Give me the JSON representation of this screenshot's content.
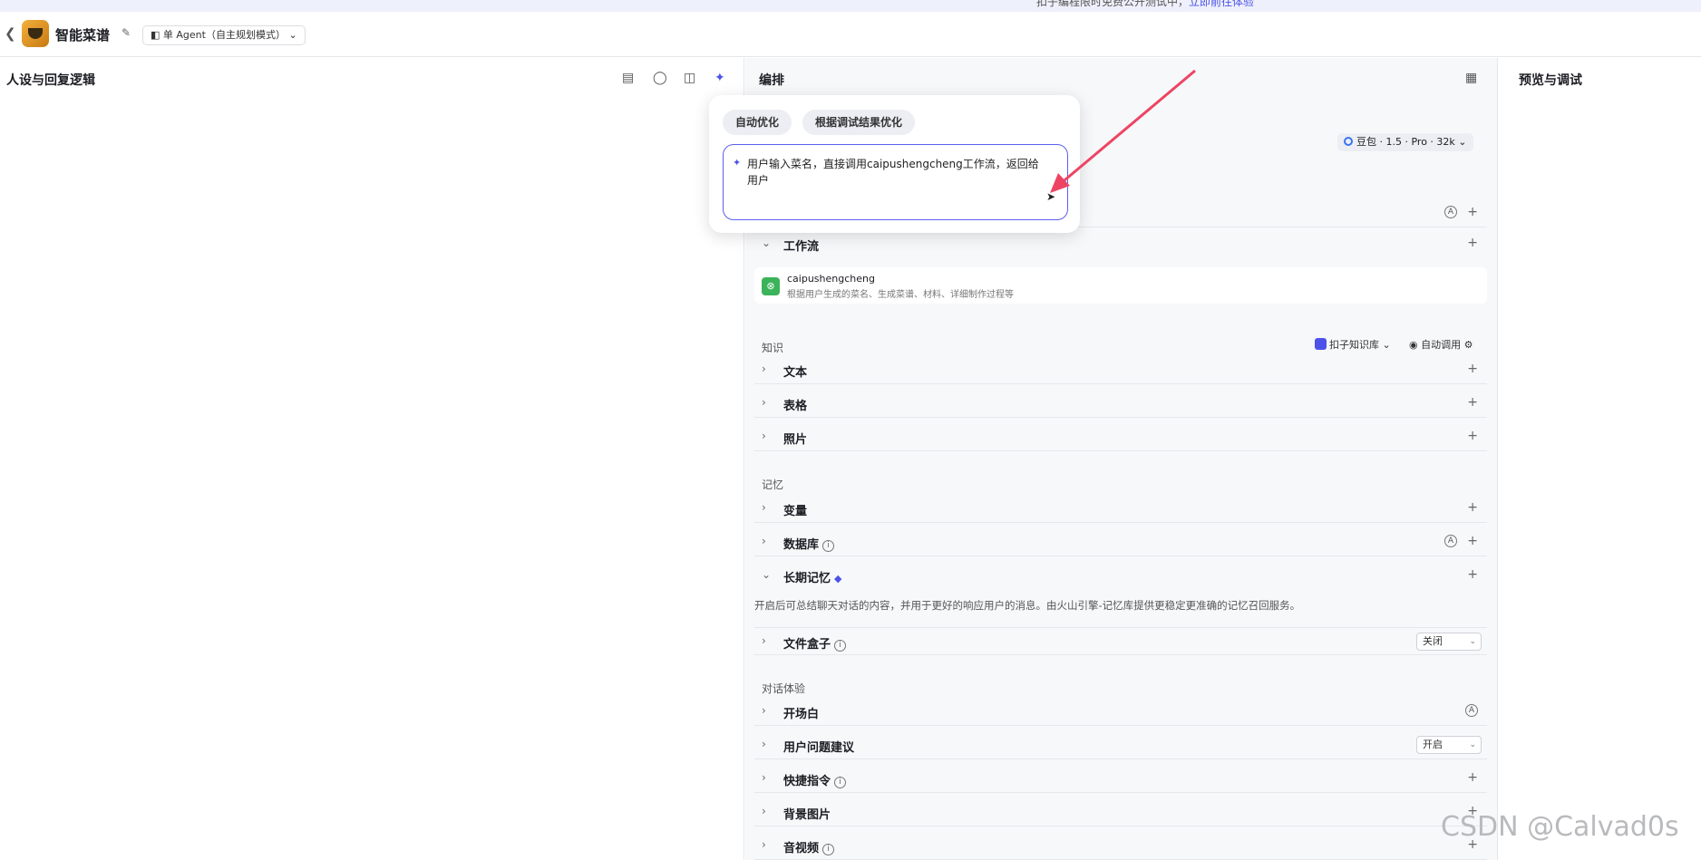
{
  "banner": {
    "text": "扣子编程限时免费公开测试中，",
    "link": "立即前往体验"
  },
  "header": {
    "app_name": "智能菜谱",
    "mode_label": "单 Agent（自主规划模式）"
  },
  "left_panel": {
    "title": "人设与回复逻辑"
  },
  "middle_panel": {
    "title": "编排",
    "model": "豆包 · 1.5 · Pro · 32k",
    "workflow_group": {
      "label": "工作流",
      "item_name": "caipushengcheng",
      "item_desc": "根据用户生成的菜名、生成菜谱、材料、详细制作过程等"
    },
    "knowledge": {
      "label": "知识",
      "kb_source": "扣子知识库",
      "call_mode": "自动调用",
      "items": [
        "文本",
        "表格",
        "照片"
      ]
    },
    "memory": {
      "label": "记忆",
      "variables": "变量",
      "database": "数据库",
      "long_term": "长期记忆",
      "long_term_desc": "开启后可总结聊天对话的内容，并用于更好的响应用户的消息。由火山引擎-记忆库提供更稳定更准确的记忆召回服务。",
      "file_box": "文件盒子",
      "file_box_value": "关闭"
    },
    "experience": {
      "label": "对话体验",
      "opening": "开场白",
      "suggestions": "用户问题建议",
      "suggestions_value": "开启",
      "shortcuts": "快捷指令",
      "background": "背景图片",
      "media": "音视频"
    }
  },
  "right_panel": {
    "title": "预览与调试"
  },
  "popup": {
    "chip_auto": "自动优化",
    "chip_debug": "根据调试结果优化",
    "prompt": "用户输入菜名，直接调用caipushengcheng工作流，返回给用户"
  },
  "watermark": "CSDN @Calvad0s",
  "colors": {
    "accent": "#4d53e8",
    "annotation_arrow": "#ee4463"
  }
}
